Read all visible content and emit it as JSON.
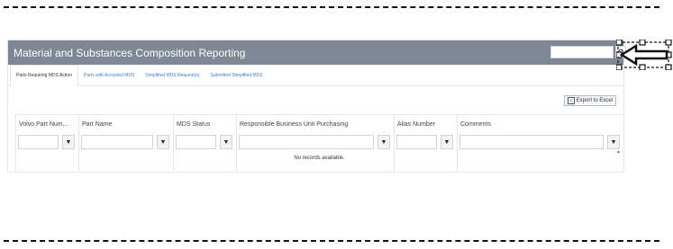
{
  "app": {
    "title": "Material and Substances Composition Reporting",
    "search_value": "",
    "gear_icon": "gear-icon"
  },
  "tabs": [
    {
      "label": "Parts Requiring MDS Action",
      "active": true
    },
    {
      "label": "Parts with Accepted MDS",
      "active": false
    },
    {
      "label": "Simplified MDS Request(s)",
      "active": false
    },
    {
      "label": "Submitted Simplified MDS",
      "active": false
    }
  ],
  "toolbar": {
    "export_label": "Export to Excel"
  },
  "grid": {
    "columns": [
      {
        "label": "Volvo Part Num..."
      },
      {
        "label": "Part Name"
      },
      {
        "label": "MDS Status"
      },
      {
        "label": "Responsible Business Unit Purchasing"
      },
      {
        "label": "Alias Number"
      },
      {
        "label": "Comments"
      }
    ],
    "empty_message": "No records available."
  },
  "colors": {
    "titlebar": "#7d8894",
    "tab_link": "#3a7ec9"
  }
}
